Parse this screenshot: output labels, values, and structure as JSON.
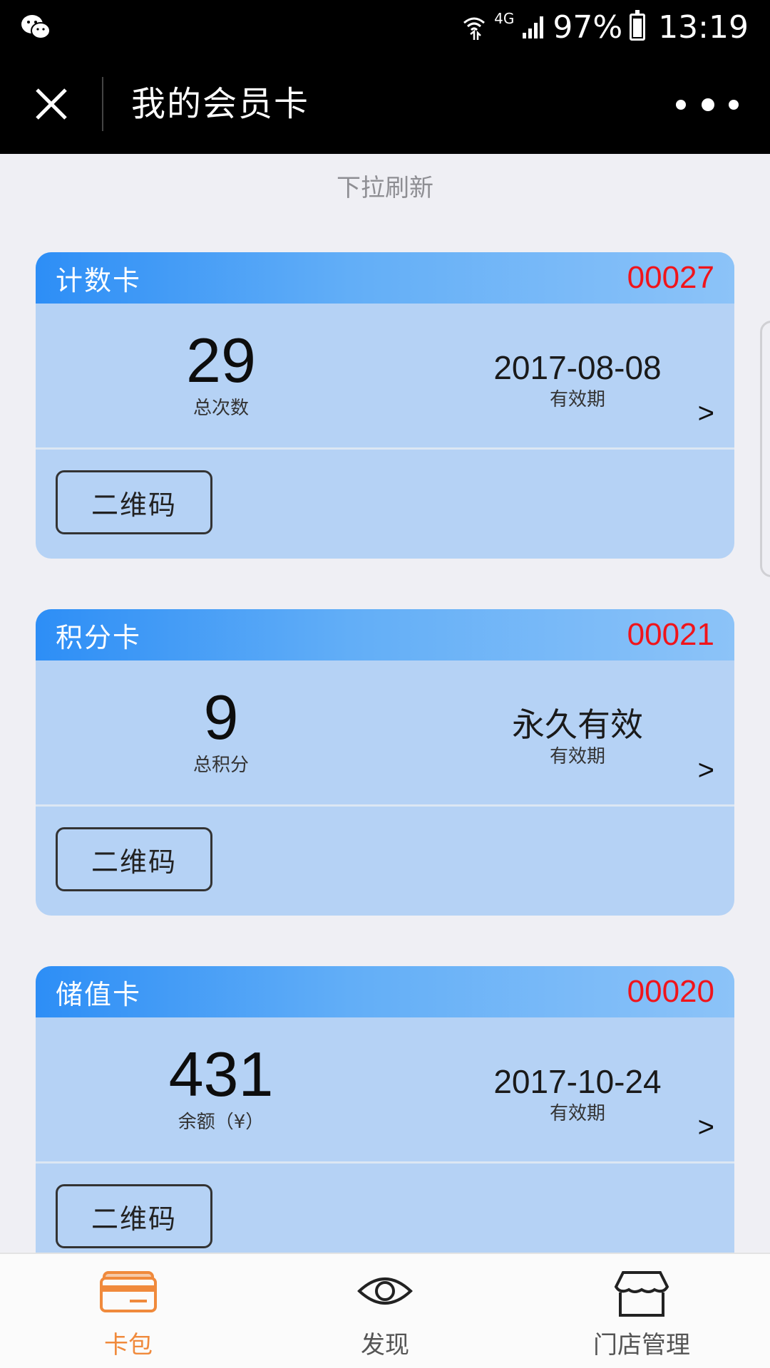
{
  "status_bar": {
    "network": "4G",
    "battery": "97%",
    "time": "13:19"
  },
  "nav": {
    "title": "我的会员卡"
  },
  "pull_refresh": "下拉刷新",
  "cards": [
    {
      "type": "计数卡",
      "number": "00027",
      "value": "29",
      "value_label": "总次数",
      "expiry": "2017-08-08",
      "expiry_label": "有效期",
      "arrow": ">",
      "qr_label": "二维码"
    },
    {
      "type": "积分卡",
      "number": "00021",
      "value": "9",
      "value_label": "总积分",
      "expiry": "永久有效",
      "expiry_label": "有效期",
      "arrow": ">",
      "qr_label": "二维码"
    },
    {
      "type": "储值卡",
      "number": "00020",
      "value": "431",
      "value_label": "余额（¥）",
      "expiry": "2017-10-24",
      "expiry_label": "有效期",
      "arrow": ">",
      "qr_label": "二维码"
    }
  ],
  "tabs": [
    {
      "label": "卡包",
      "icon": "card-wallet-icon",
      "active": true
    },
    {
      "label": "发现",
      "icon": "eye-icon",
      "active": false
    },
    {
      "label": "门店管理",
      "icon": "store-icon",
      "active": false
    }
  ],
  "colors": {
    "active_tab": "#f08a3c",
    "inactive_tab": "#555555",
    "card_number": "#f0141b",
    "card_body": "#b5d2f5",
    "card_header_start": "#2d8ef6",
    "card_header_end": "#8cc3f8"
  }
}
